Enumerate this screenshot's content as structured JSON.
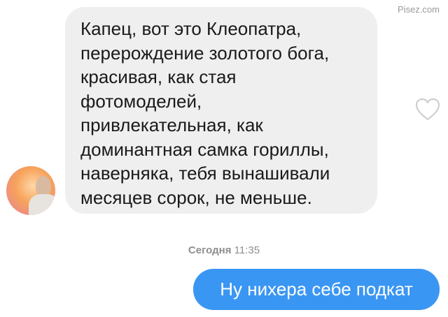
{
  "watermark": "Pisez.com",
  "incoming_message": {
    "text": "Капец, вот это Клеопатра,\nперерождение золотого бога,\nкрасивая, как стая\nфотомоделей,\nпривлекательная, как\nдоминантная самка гориллы,\nнаверняка, тебя вынашивали\nмесяцев сорок, не меньше.",
    "reaction_icon": "heart-outline-icon"
  },
  "avatar_icon": "user-avatar-photo",
  "timestamp": {
    "day": "Сегодня",
    "time": "11:35"
  },
  "outgoing_message": {
    "text": "Ну нихера себе подкат"
  },
  "colors": {
    "incoming_bubble": "#efefef",
    "outgoing_bubble": "#3a96f3",
    "background": "#ffffff"
  }
}
